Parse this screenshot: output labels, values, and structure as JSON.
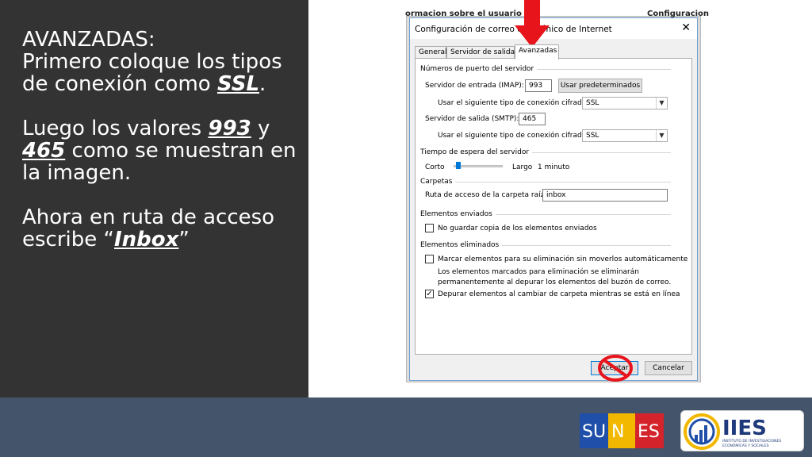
{
  "slide": {
    "line1": "AVANZADAS:",
    "p1_prefix": "Primero coloque los tipos de conexión como ",
    "p1_highlight": "SSL",
    "p1_suffix": ".",
    "p2_prefix": "Luego los valores ",
    "p2_hl1": "993",
    "p2_mid": " y ",
    "p2_hl2": "465",
    "p2_suffix": " como se muestran en la imagen.",
    "p3_prefix": "Ahora en ruta de acceso escribe “",
    "p3_highlight": "Inbox",
    "p3_suffix": "”"
  },
  "background": {
    "left_text": "ormacion sobre el usuario",
    "right_text": "Configuracion"
  },
  "dialog": {
    "title": "Configuración de correo electrónico de Internet",
    "close_label": "✕",
    "tabs": [
      "General",
      "Servidor de salida",
      "Avanzadas"
    ],
    "ports_group": "Números de puerto del servidor",
    "imap_label": "Servidor de entrada (IMAP):",
    "imap_value": "993",
    "defaults_button": "Usar predeterminados",
    "enc_label_in": "Usar el siguiente tipo de conexión cifrada:",
    "enc_value_in": "SSL",
    "smtp_label": "Servidor de salida (SMTP):",
    "smtp_value": "465",
    "enc_label_out": "Usar el siguiente tipo de conexión cifrada:",
    "enc_value_out": "SSL",
    "timeout_group": "Tiempo de espera del servidor",
    "short_label": "Corto",
    "long_label": "Largo",
    "timeout_value": "1 minuto",
    "folders_group": "Carpetas",
    "root_label": "Ruta de acceso de la carpeta raíz:",
    "root_value": "inbox",
    "sent_group": "Elementos enviados",
    "no_copy_label": "No guardar copia de los elementos enviados",
    "deleted_group": "Elementos eliminados",
    "mark_label": "Marcar elementos para su eliminación sin moverlos automáticamente",
    "info_line1": "Los elementos marcados para eliminación se eliminarán",
    "info_line2": "permanentemente al depurar los elementos del buzón de correo.",
    "purge_label": "Depurar elementos al cambiar de carpeta mientras se está en línea",
    "accept_button": "Aceptar",
    "cancel_button": "Cancelar"
  },
  "logos": {
    "sunes": "SU NES",
    "iies": "IIES",
    "iies_sub1": "INSTITUTO DE INVESTIGACIONES",
    "iies_sub2": "ECONÓMICAS Y SOCIALES"
  },
  "colors": {
    "left_panel": "#333333",
    "footer": "#44546a",
    "annotation_red": "#e8141b"
  }
}
